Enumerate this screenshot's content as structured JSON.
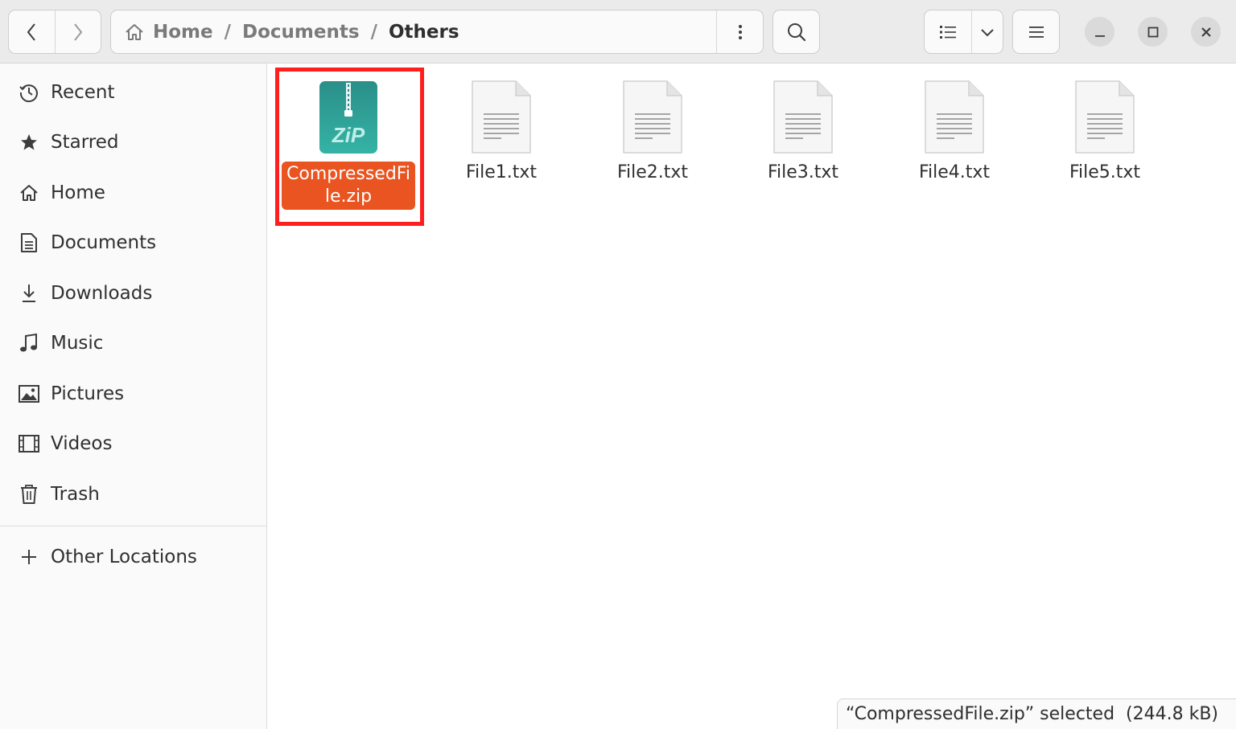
{
  "nav": {
    "back_icon": "chevron-left-icon",
    "forward_icon": "chevron-right-icon"
  },
  "pathbar": {
    "home_icon": "home-icon",
    "crumbs": [
      "Home",
      "Documents",
      "Others"
    ],
    "separator": "/",
    "menu_icon": "vertical-dots-icon"
  },
  "toolbar": {
    "search_icon": "search-icon",
    "view_icon": "list-view-icon",
    "view_dropdown_icon": "chevron-down-icon",
    "menu_icon": "hamburger-icon"
  },
  "window_controls": {
    "minimize_icon": "minimize-icon",
    "maximize_icon": "maximize-icon",
    "close_icon": "close-icon"
  },
  "sidebar": {
    "items": [
      {
        "label": "Recent",
        "icon": "clock-icon"
      },
      {
        "label": "Starred",
        "icon": "star-icon"
      },
      {
        "label": "Home",
        "icon": "home-icon"
      },
      {
        "label": "Documents",
        "icon": "document-icon"
      },
      {
        "label": "Downloads",
        "icon": "download-icon"
      },
      {
        "label": "Music",
        "icon": "music-note-icon"
      },
      {
        "label": "Pictures",
        "icon": "picture-icon"
      },
      {
        "label": "Videos",
        "icon": "film-icon"
      },
      {
        "label": "Trash",
        "icon": "trash-icon"
      }
    ],
    "other_locations": {
      "label": "Other Locations",
      "icon": "plus-icon"
    }
  },
  "files": [
    {
      "name": "CompressedFile.zip",
      "display_name": "CompressedFile.zip",
      "type": "zip",
      "selected": true,
      "icon": "zip-archive-icon",
      "icon_text": "ZiP"
    },
    {
      "name": "File1.txt",
      "type": "txt",
      "selected": false,
      "icon": "text-file-icon"
    },
    {
      "name": "File2.txt",
      "type": "txt",
      "selected": false,
      "icon": "text-file-icon"
    },
    {
      "name": "File3.txt",
      "type": "txt",
      "selected": false,
      "icon": "text-file-icon"
    },
    {
      "name": "File4.txt",
      "type": "txt",
      "selected": false,
      "icon": "text-file-icon"
    },
    {
      "name": "File5.txt",
      "type": "txt",
      "selected": false,
      "icon": "text-file-icon"
    }
  ],
  "status": {
    "text": "“CompressedFile.zip” selected  (244.8 kB)"
  },
  "colors": {
    "selection": "#e95420",
    "highlight_box": "#ff1f1f",
    "zip_teal": "#2a9d94"
  }
}
